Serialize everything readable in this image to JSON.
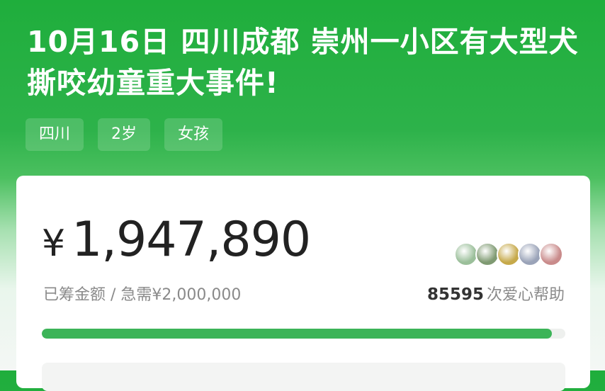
{
  "header": {
    "title": "10月16日 四川成都 崇州一小区有大型犬撕咬幼童重大事件!",
    "tags": [
      "四川",
      "2岁",
      "女孩"
    ]
  },
  "fundraising": {
    "currency_symbol": "¥",
    "raised": "1,947,890",
    "goal_text": "已筹金额 / 急需¥2,000,000",
    "helper_count": "85595",
    "helper_text": "次爱心帮助",
    "progress_fraction": 0.974
  },
  "avatars": [
    {
      "name": "avatar",
      "color": "#9bbf9a"
    },
    {
      "name": "avatar",
      "color": "#7f9a72"
    },
    {
      "name": "avatar",
      "color": "#c6a94a"
    },
    {
      "name": "avatar",
      "color": "#9aa3b8"
    },
    {
      "name": "avatar",
      "color": "#c98b8b"
    }
  ],
  "colors": {
    "brand_green": "#2db24a",
    "progress": "#3cb458"
  }
}
